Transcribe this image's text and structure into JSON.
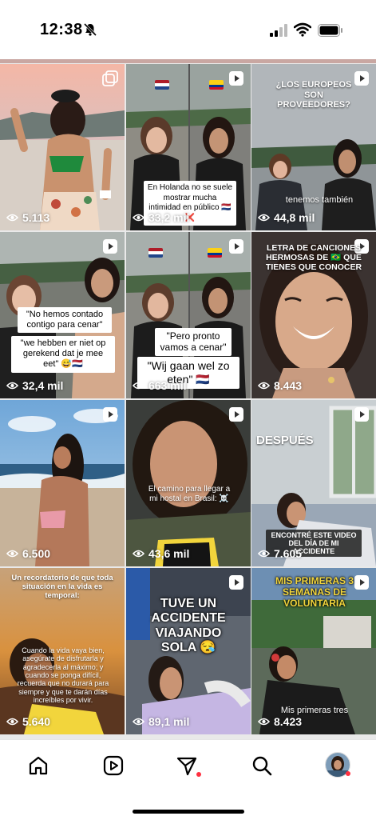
{
  "status_bar": {
    "time": "12:38"
  },
  "grid": {
    "tiles": [
      {
        "id": "t1",
        "views": "5.113",
        "type": "carousel"
      },
      {
        "id": "t2",
        "views": "33,2 mil",
        "type": "reel",
        "caption": "En Holanda no se suele mostrar mucha intimidad en público 🇳🇱❌"
      },
      {
        "id": "t3",
        "views": "44,8 mil",
        "type": "reel",
        "caption_top": "¿LOS EUROPEOS SON PROVEEDORES?",
        "caption_bottom": "tenemos también"
      },
      {
        "id": "t4",
        "views": "32,4 mil",
        "type": "reel",
        "caption_1": "\"No hemos contado contigo para cenar\"",
        "caption_2": "\"we hebben er niet op gerekend dat je mee eet\" 😅🇳🇱"
      },
      {
        "id": "t5",
        "views": "663 mil",
        "type": "reel",
        "caption_1": "\"Pero pronto vamos a cenar\"",
        "caption_2": "\"Wij gaan wel zo eten\" 🇳🇱"
      },
      {
        "id": "t6",
        "views": "8.443",
        "type": "reel",
        "caption": "LETRA DE CANCIONES HERMOSAS DE 🇧🇷 QUE TIENES QUE CONOCER"
      },
      {
        "id": "t7",
        "views": "6.500",
        "type": "reel"
      },
      {
        "id": "t8",
        "views": "43,6 mil",
        "type": "reel",
        "caption": "El camino para llegar a mi hostal en Brasil: ☠️"
      },
      {
        "id": "t9",
        "views": "7.605",
        "type": "reel",
        "caption_top": "DESPUÉS",
        "caption_bottom": "ENCONTRÉ ESTE VIDEO DEL DÍA DE MI ACCIDENTE"
      },
      {
        "id": "t10",
        "views": "5.640",
        "type": "reel",
        "caption_top": "Un recordatorio de que toda situación en la vida es temporal:",
        "caption_mid": "Cuando la vida vaya bien, asegúrate de disfrutarla y agradecerla al máximo; y cuando se ponga difícil, recuerda que no durará para siempre y que te darán días increíbles por vivir."
      },
      {
        "id": "t11",
        "views": "89,1 mil",
        "type": "reel",
        "caption": "TUVE UN ACCIDENTE VIAJANDO SOLA 😪"
      },
      {
        "id": "t12",
        "views": "8.423",
        "type": "reel",
        "caption_top": "MIS PRIMERAS 3 SEMANAS DE VOLUNTARIA",
        "caption_bottom": "Mis primeras tres"
      }
    ]
  },
  "bottom_nav": {
    "items": [
      "home",
      "reels",
      "messages",
      "search",
      "profile"
    ]
  },
  "colors": {
    "notification_dot": "#ff3040",
    "accent_yellow": "#f2d53c"
  }
}
